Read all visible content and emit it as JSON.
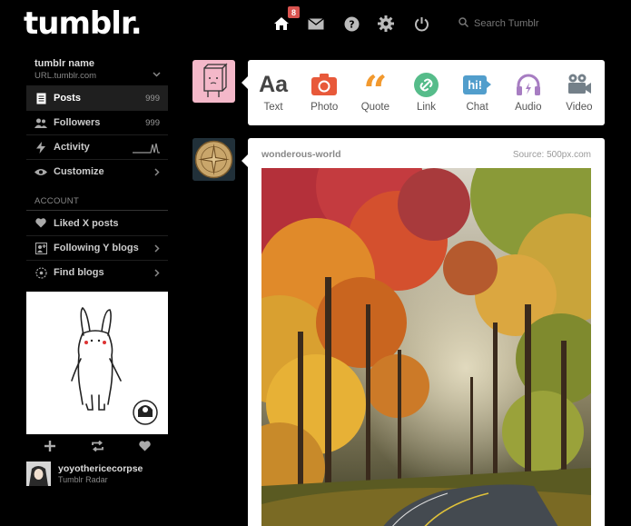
{
  "header": {
    "logo": "tumblr.",
    "badge_count": "8",
    "nav_icons": [
      "home-icon",
      "mail-icon",
      "help-icon",
      "gear-icon",
      "power-icon"
    ],
    "search_placeholder": "Search Tumblr"
  },
  "sidebar": {
    "blog_name": "tumblr name",
    "blog_url": "URL.tumblr.com",
    "items": [
      {
        "label": "Posts",
        "count": "999",
        "icon": "document-icon"
      },
      {
        "label": "Followers",
        "count": "999",
        "icon": "people-icon"
      },
      {
        "label": "Activity",
        "icon": "lightning-icon"
      },
      {
        "label": "Customize",
        "icon": "eye-icon"
      }
    ],
    "account_label": "ACCOUNT",
    "account_items": [
      {
        "label": "Liked X posts",
        "icon": "heart-icon"
      },
      {
        "label": "Following Y blogs",
        "icon": "follow-icon"
      },
      {
        "label": "Find blogs",
        "icon": "compass-icon"
      }
    ]
  },
  "radar": {
    "username": "yoyothericecorpse",
    "label": "Tumblr Radar"
  },
  "composer": {
    "types": [
      {
        "label": "Text",
        "glyph": "Aa",
        "color": "#444444"
      },
      {
        "label": "Photo",
        "color": "#e8593a"
      },
      {
        "label": "Quote",
        "glyph": "“",
        "color": "#f2992e"
      },
      {
        "label": "Link",
        "color": "#56bc8a"
      },
      {
        "label": "Chat",
        "glyph": "hi!",
        "color": "#529ecc"
      },
      {
        "label": "Audio",
        "color": "#a77dc2"
      },
      {
        "label": "Video",
        "color": "#748089"
      }
    ]
  },
  "post": {
    "author": "wonderous-world",
    "source": "Source: 500px.com"
  },
  "colors": {
    "background": "#000000",
    "badge": "#d9534f",
    "avatar_pink": "#f4b8c9"
  }
}
